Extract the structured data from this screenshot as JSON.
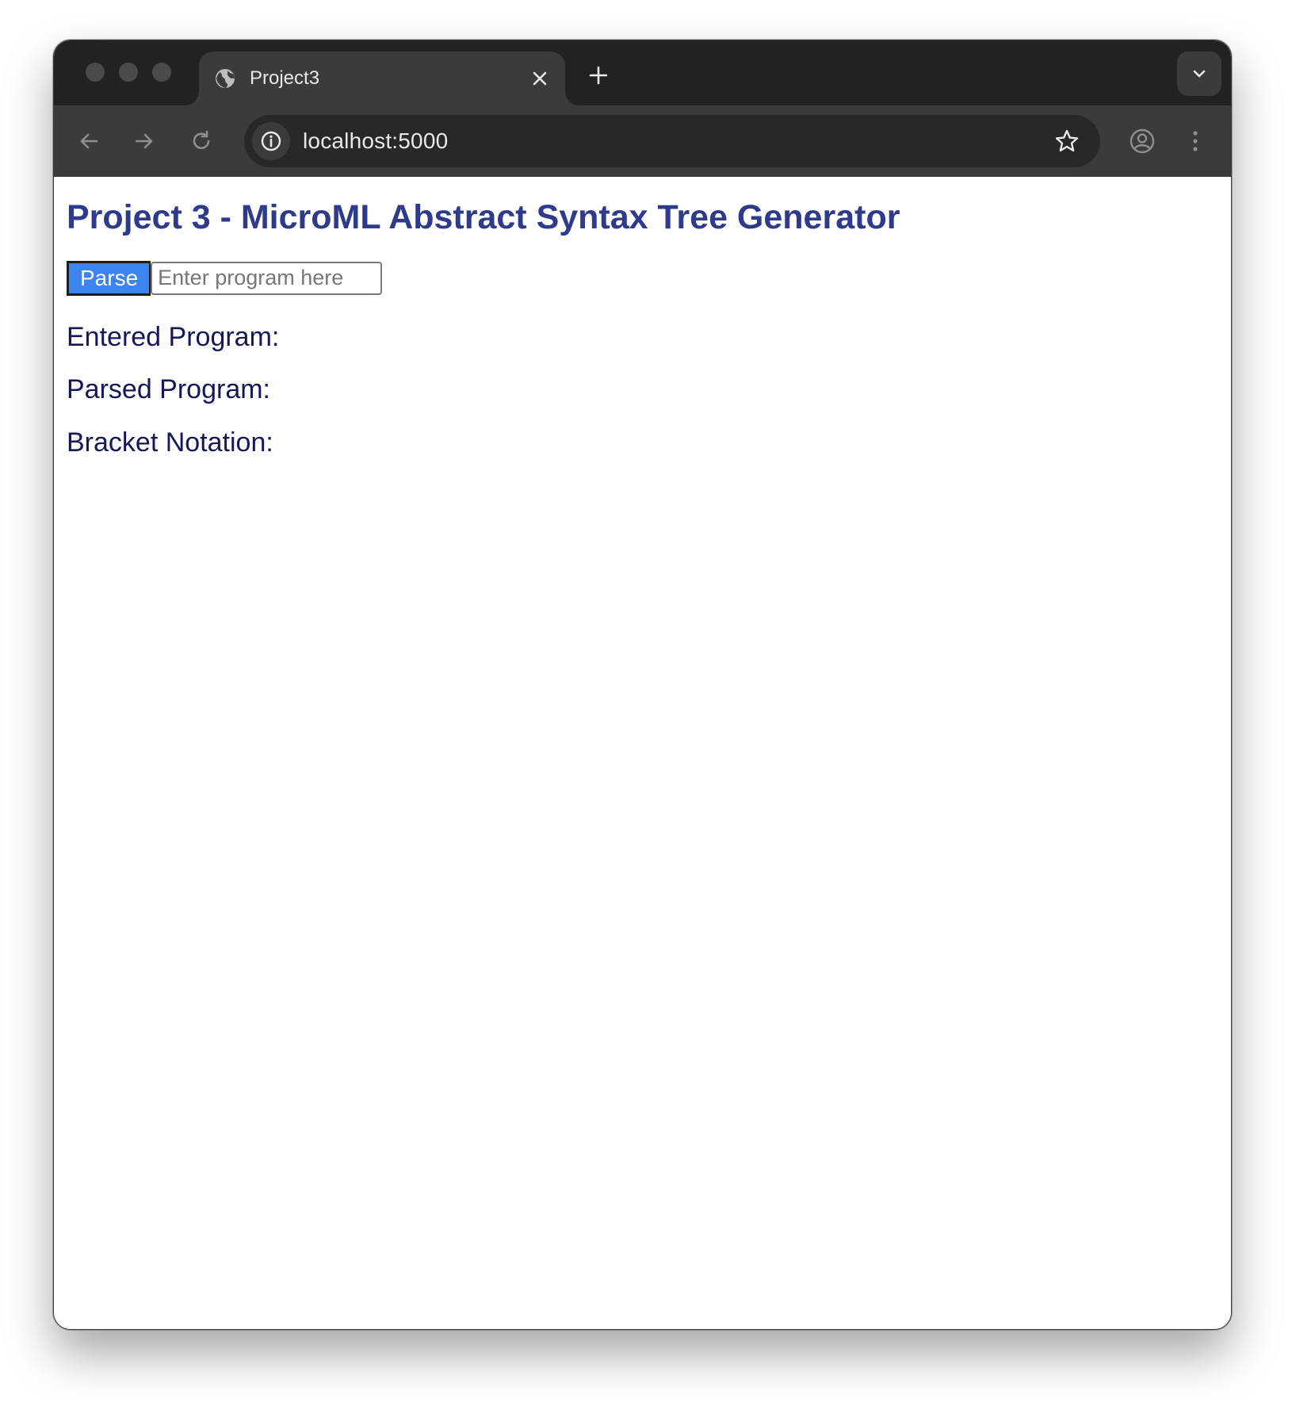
{
  "browser": {
    "tab_title": "Project3",
    "url": "localhost:5000",
    "icons": {
      "tab_favicon": "globe-icon",
      "tab_close": "close-icon",
      "new_tab": "plus-icon",
      "tab_search": "chevron-down-icon",
      "back": "arrow-left-icon",
      "forward": "arrow-right-icon",
      "reload": "reload-icon",
      "site_info": "info-icon",
      "bookmark": "star-icon",
      "profile": "profile-icon",
      "menu": "kebab-menu-icon"
    }
  },
  "page": {
    "title": "Project 3 - MicroML Abstract Syntax Tree Generator",
    "parse_button_label": "Parse",
    "program_input": {
      "value": "",
      "placeholder": "Enter program here"
    },
    "entered_program_label": "Entered Program:",
    "parsed_program_label": "Parsed Program:",
    "bracket_notation_label": "Bracket Notation:"
  },
  "colors": {
    "title": "#2e3a8c",
    "labels": "#14185a",
    "parse_button_bg": "#3d84f0",
    "browser_chrome": "#3b3b3c"
  }
}
